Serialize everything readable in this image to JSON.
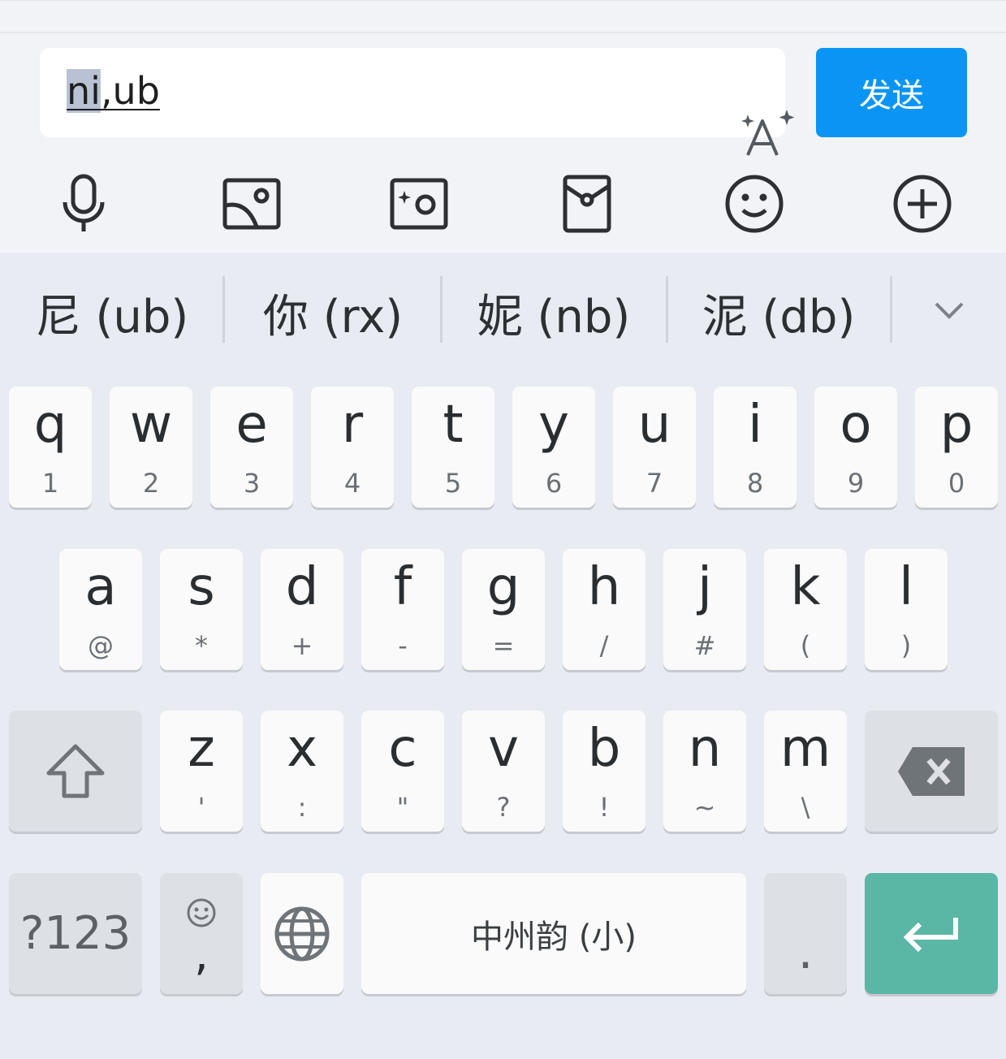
{
  "input": {
    "selected": "ni",
    "rest": ",ub"
  },
  "send_label": "发送",
  "toolbar": [
    "mic-icon",
    "image-icon",
    "camera-icon",
    "red-packet-icon",
    "emoji-icon",
    "plus-circle-icon"
  ],
  "candidates": [
    "尼 (ub)",
    "你 (rx)",
    "妮 (nb)",
    "泥 (db)"
  ],
  "row1": [
    {
      "k": "q",
      "s": "1"
    },
    {
      "k": "w",
      "s": "2"
    },
    {
      "k": "e",
      "s": "3"
    },
    {
      "k": "r",
      "s": "4"
    },
    {
      "k": "t",
      "s": "5"
    },
    {
      "k": "y",
      "s": "6"
    },
    {
      "k": "u",
      "s": "7"
    },
    {
      "k": "i",
      "s": "8"
    },
    {
      "k": "o",
      "s": "9"
    },
    {
      "k": "p",
      "s": "0"
    }
  ],
  "row2": [
    {
      "k": "a",
      "s": "@"
    },
    {
      "k": "s",
      "s": "*"
    },
    {
      "k": "d",
      "s": "+"
    },
    {
      "k": "f",
      "s": "-"
    },
    {
      "k": "g",
      "s": "="
    },
    {
      "k": "h",
      "s": "/"
    },
    {
      "k": "j",
      "s": "#"
    },
    {
      "k": "k",
      "s": "("
    },
    {
      "k": "l",
      "s": ")"
    }
  ],
  "row3": [
    {
      "k": "z",
      "s": "'"
    },
    {
      "k": "x",
      "s": ":"
    },
    {
      "k": "c",
      "s": "\""
    },
    {
      "k": "v",
      "s": "?"
    },
    {
      "k": "b",
      "s": "!"
    },
    {
      "k": "n",
      "s": "~"
    },
    {
      "k": "m",
      "s": "\\"
    }
  ],
  "bottom": {
    "symbols": "?123",
    "comma": ",",
    "space": "中州韵 (小)",
    "period": "."
  },
  "colors": {
    "send": "#0a95f5",
    "enter": "#5ab7a6",
    "key": "#fafafa",
    "key_gray": "#dde0e5",
    "bg": "#e8ebf2"
  }
}
